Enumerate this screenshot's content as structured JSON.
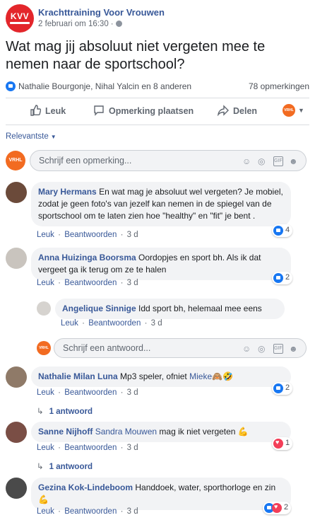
{
  "post": {
    "page_name": "Krachttraining Voor Vrouwen",
    "logo_text": "KVV",
    "timestamp": "2 februari om 16:30",
    "dot": "·",
    "text": "Wat mag jij absoluut niet vergeten mee te nemen naar de sportschool?",
    "reaction_names": "Nathalie Bourgonje, Nihal Yalcin en 8 anderen",
    "comment_count": "78 opmerkingen"
  },
  "actions": {
    "like": "Leuk",
    "comment": "Opmerking plaatsen",
    "share": "Delen",
    "profile_badge": "VRHL"
  },
  "sort_label": "Relevantste",
  "comment_input": {
    "placeholder": "Schrijf een opmerking...",
    "avatar": "VRHL"
  },
  "reply_input": {
    "placeholder": "Schrijf een antwoord...",
    "avatar": "VRHL"
  },
  "meta_labels": {
    "like": "Leuk",
    "reply": "Beantwoorden",
    "sep": "·"
  },
  "comments": [
    {
      "author": "Mary Hermans",
      "text": "En wat mag je absoluut wel vergeten? Je mobiel, zodat je geen foto's van jezelf kan nemen in de spiegel van de sportschool om te laten zien hoe \"healthy\" en \"fit\" je bent .",
      "age": "3 d",
      "reactions": "4"
    },
    {
      "author": "Anna Huizinga Boorsma",
      "text": "Oordopjes en sport bh. Als ik dat vergeet ga ik terug om ze te halen",
      "age": "3 d",
      "reactions": "2"
    },
    {
      "author": "Angelique Sinnige",
      "text": "Idd sport bh, helemaal mee eens",
      "age": "3 d"
    },
    {
      "author": "Nathalie Milan Luna",
      "text": "Mp3 speler, ofniet",
      "mention": "Mieke",
      "emoji": "🙈🤣",
      "age": "3 d",
      "reactions": "2",
      "replies": "1 antwoord"
    },
    {
      "author": "Sanne Nijhoff",
      "mention": "Sandra Mouwen",
      "text": "mag ik niet vergeten",
      "emoji": "💪",
      "age": "3 d",
      "reactions": "1",
      "replies": "1 antwoord"
    },
    {
      "author": "Gezina Kok-Lindeboom",
      "text": "Handdoek, water, sporthorloge en zin",
      "emoji": "💪",
      "age": "3 d",
      "reactions": "2"
    }
  ],
  "colors": {
    "link": "#385898",
    "brand_red": "#e3262b",
    "vrhl_orange": "#f26b21",
    "like_blue": "#1877f2",
    "love_red": "#f33e58"
  }
}
